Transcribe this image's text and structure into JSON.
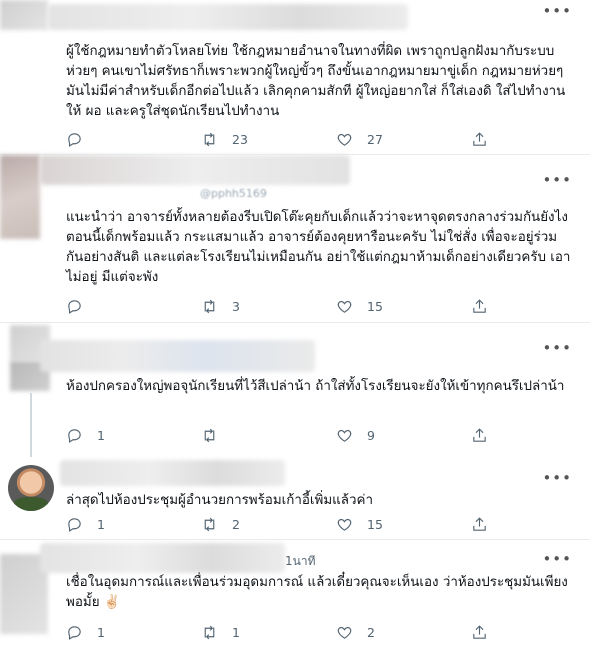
{
  "tweets": [
    {
      "text": "ผู้ใช้กฎหมายทำตัวโหลยโท่ย ใช้กฎหมายอำนาจในทางที่ผิด เพราถูกปลูกฝังมากับระบบห่วยๆ คนเขาไม่ศรัทธาก็เพราะพวกผู้ใหญ่ขั้วๆ ถึงขั้นเอากฎหมายมาขู่เด็ก กฎหมายห่วยๆ มันไม่มีค่าสำหรับเด็กอีกต่อไปแล้ว เลิกคุกคามสักที ผู้ใหญ่อยากใส่ ก็ใส่เองดิ ใส่ไปทำงาน ให้ ผอ และครูใส่ชุดนักเรียนไปทำงาน",
      "reply_count": "",
      "retweet_count": "23",
      "like_count": "27"
    },
    {
      "handle_fragment": "@pphh5169",
      "text": "แนะนำว่า อาจารย์ทั้งหลายต้องรีบเปิดโต๊ะคุยกับเด็กแล้วว่าจะหาจุดตรงกลางร่วมกันยังไง ตอนนี้เด็กพร้อมแล้ว กระแสมาแล้ว อาจารย์ต้องคุยหารือนะครับ ไม่ใช่สั่ง เพื่อจะอยู่ร่วมกันอย่างสันติ และแต่ละโรงเรียนไม่เหมือนกัน อย่าใช้แต่กฎมาห้ามเด็กอย่างเดียวครับ เอาไม่อยู่ มีแต่จะพัง",
      "reply_count": "",
      "retweet_count": "3",
      "like_count": "15"
    },
    {
      "text": "ห้องปกครองใหญ่พอจุนักเรียนที่ไว้สีเปล่าน้า ถ้าใส่ทั้งโรงเรียนจะยังให้เข้าทุกคนรึเปล่าน้า",
      "reply_count": "1",
      "retweet_count": "",
      "like_count": "9"
    },
    {
      "text": "ล่าสุดไปห้องประชุมผู้อำนวยการพร้อมเก้าอี้เพิ่มแล้วค่า",
      "reply_count": "1",
      "retweet_count": "2",
      "like_count": "15"
    },
    {
      "time_fragment": "1นาที",
      "text": "เชื่อในอุดมการณ์และเพื่อนร่วมอุดมการณ์ แล้วเดี๋ยวคุณจะเห็นเอง ว่าห้องประชุมมันเพียงพอมั้ย ✌🏻",
      "reply_count": "1",
      "retweet_count": "1",
      "like_count": "2"
    }
  ],
  "more_glyph": "•••",
  "icons": [
    "reply-icon",
    "retweet-icon",
    "like-icon",
    "share-icon",
    "more-icon"
  ],
  "colors": {
    "icon": "#536471",
    "divider": "#e6ecf0",
    "text": "#0f1419"
  }
}
